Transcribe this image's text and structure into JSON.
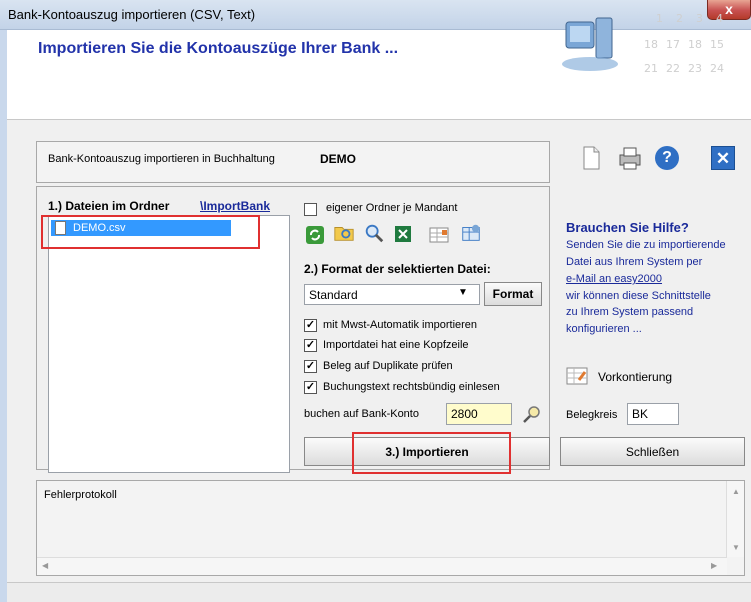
{
  "window": {
    "title": "Bank-Kontoauszug importieren (CSV, Text)",
    "close_label": "x"
  },
  "header": {
    "title": "Importieren Sie die Kontoauszüge Ihrer Bank ...",
    "calendar_dates": [
      "1",
      "2",
      "3",
      "4",
      "18",
      "17",
      "18",
      "15",
      "21",
      "22",
      "23",
      "24"
    ]
  },
  "account": {
    "label": "Bank-Kontoauszug importieren in Buchhaltung",
    "name": "DEMO"
  },
  "toolbar": {
    "icons": [
      "new-document-icon",
      "print-icon",
      "help-icon",
      "close-icon"
    ],
    "close_glyph": "✕",
    "help_glyph": "?"
  },
  "step1": {
    "label": "1.) Dateien im Ordner",
    "folder": "\\ImportBank",
    "files": [
      "DEMO.csv"
    ]
  },
  "options": {
    "own_folder": {
      "label": "eigener Ordner je Mandant",
      "checked": false
    },
    "step2": "2.) Format der selektierten Datei:",
    "format_value": "Standard",
    "format_button": "Format",
    "checks": [
      {
        "label": "mit Mwst-Automatik importieren",
        "checked": true
      },
      {
        "label": "Importdatei hat eine Kopfzeile",
        "checked": true
      },
      {
        "label": "Beleg auf Duplikate prüfen",
        "checked": true
      },
      {
        "label": "Buchungstext rechtsbündig einlesen",
        "checked": true
      }
    ],
    "bank_label": "buchen auf Bank-Konto",
    "bank_value": "2800",
    "import_button": "3.) Importieren",
    "import_underline": "I"
  },
  "help": {
    "title": "Brauchen Sie Hilfe?",
    "line1": "Senden Sie die zu importierende",
    "line2": "Datei aus Ihrem System per",
    "link": "e-Mail an easy2000",
    "line3": "wir können diese Schnittstelle",
    "line4": "zu Ihrem System passend",
    "line5": "konfigurieren ..."
  },
  "vorkontierung": {
    "label": "Vorkontierung"
  },
  "belegkreis": {
    "label": "Belegkreis",
    "value": "BK"
  },
  "close_button": "Schließen",
  "error_log": {
    "label": "Fehlerprotokoll"
  },
  "colors": {
    "accent": "#1a2a9a",
    "highlight": "#e03030",
    "selection": "#3399ff"
  }
}
